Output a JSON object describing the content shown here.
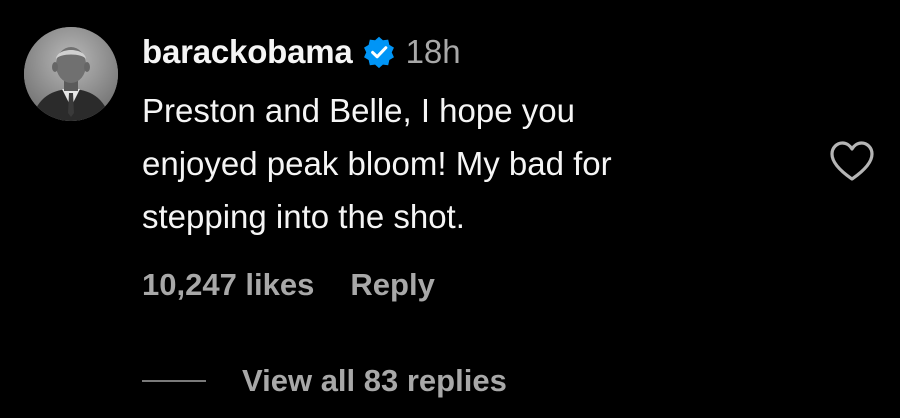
{
  "comment": {
    "avatar_icon": "profile-photo",
    "username": "barackobama",
    "verified_icon": "verified-badge-icon",
    "verified_color": "#0095f6",
    "time": "18h",
    "text_lines": [
      "Preston and Belle, I hope you",
      "enjoyed peak bloom! My bad for",
      "stepping into the shot."
    ],
    "like_icon": "heart-outline-icon",
    "likes": "10,247 likes",
    "reply_label": "Reply",
    "view_replies_label": "View all 83 replies"
  },
  "colors": {
    "background": "#000000",
    "primary_text": "#f5f5f5",
    "secondary_text": "#a8a8a8"
  }
}
